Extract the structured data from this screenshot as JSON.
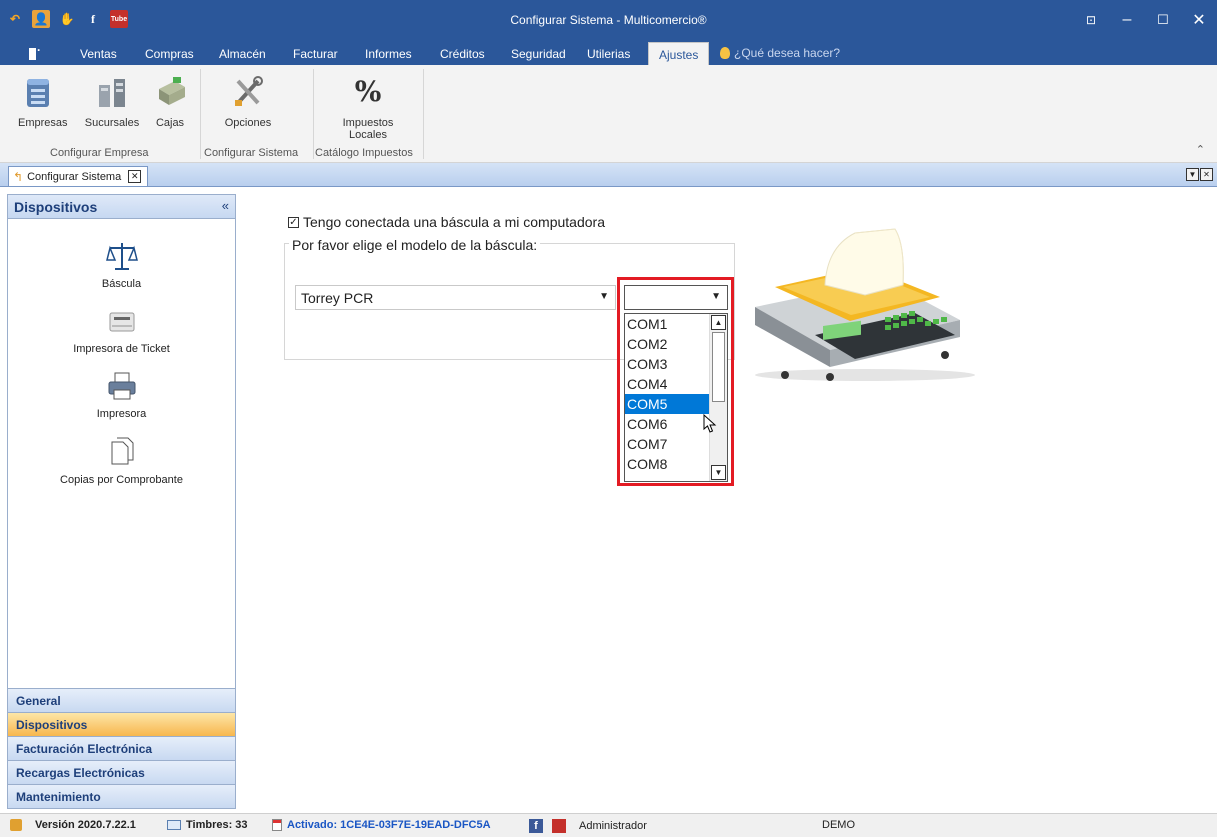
{
  "window": {
    "title": "Configurar Sistema - Multicomercio®",
    "qat_youtube_label": "Tube"
  },
  "menu": {
    "items": [
      "Ventas",
      "Compras",
      "Almacén",
      "Facturar",
      "Informes",
      "Créditos",
      "Seguridad",
      "Utilerias",
      "Ajustes"
    ],
    "active": "Ajustes",
    "search_hint": "¿Qué desea hacer?"
  },
  "ribbon": {
    "empresas": "Empresas",
    "sucursales": "Sucursales",
    "cajas": "Cajas",
    "opciones": "Opciones",
    "impuestos_line1": "Impuestos",
    "impuestos_line2": "Locales",
    "impuestos_symbol": "%",
    "groups": [
      "Configurar Empresa",
      "Configurar Sistema",
      "Catálogo Impuestos"
    ]
  },
  "doc_tab": {
    "label": "Configurar Sistema"
  },
  "left_pane": {
    "title": "Dispositivos",
    "devices": [
      "Báscula",
      "Impresora de Ticket",
      "Impresora",
      "Copias por Comprobante"
    ],
    "nav": [
      "General",
      "Dispositivos",
      "Facturación Electrónica",
      "Recargas Electrónicas",
      "Mantenimiento"
    ],
    "active_nav": "Dispositivos"
  },
  "main": {
    "scale_checkbox_label": "Tengo conectada una báscula a mi computadora",
    "scale_checked": true,
    "model_group_label": "Por favor elige el modelo de la báscula:",
    "model_value": "Torrey PCR",
    "port_value": "",
    "port_options": [
      "COM1",
      "COM2",
      "COM3",
      "COM4",
      "COM5",
      "COM6",
      "COM7",
      "COM8"
    ],
    "port_highlighted": "COM5"
  },
  "status": {
    "version": "Versión 2020.7.22.1",
    "timbres": "Timbres: 33",
    "activado": "Activado: 1CE4E-03F7E-19EAD-DFC5A",
    "user": "Administrador",
    "mode": "DEMO"
  },
  "colors": {
    "title_bar": "#2b579a",
    "highlight": "#0078d7",
    "red_frame": "#e31b23",
    "active_nav": "#f7b74e"
  }
}
